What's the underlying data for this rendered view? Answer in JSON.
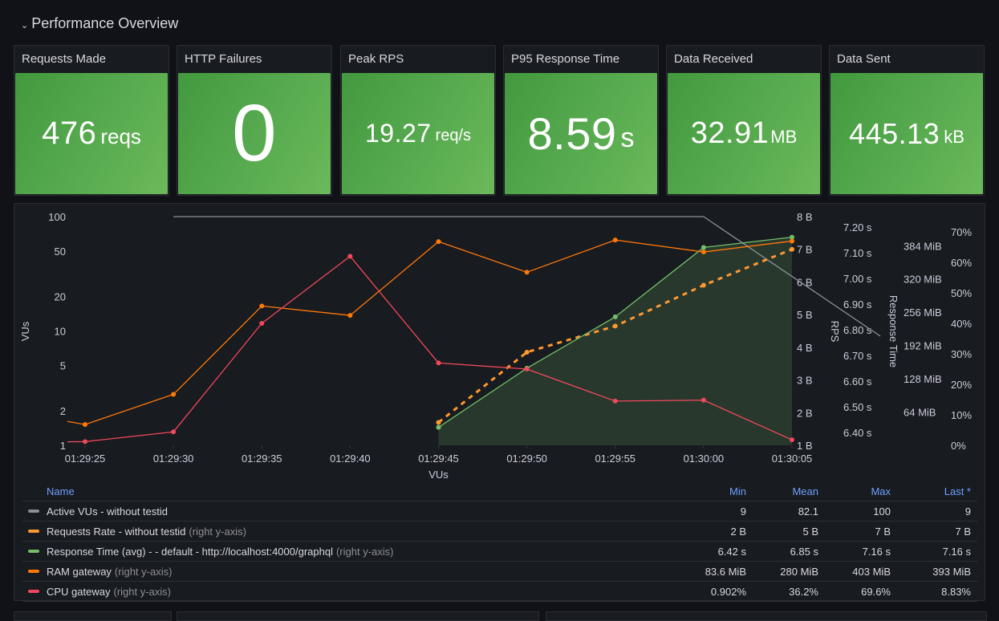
{
  "row": {
    "title": "Performance Overview",
    "collapse_icon": "chevron-down-icon"
  },
  "stats": [
    {
      "title": "Requests Made",
      "value": "476",
      "unit": "reqs"
    },
    {
      "title": "HTTP Failures",
      "value": "0",
      "unit": ""
    },
    {
      "title": "Peak RPS",
      "value": "19.27",
      "unit": "req/s"
    },
    {
      "title": "P95 Response Time",
      "value": "8.59",
      "unit": "s"
    },
    {
      "title": "Data Received",
      "value": "32.91",
      "unit": "MB"
    },
    {
      "title": "Data Sent",
      "value": "445.13",
      "unit": "kB"
    }
  ],
  "colors": {
    "stat_bg": "#56a94e",
    "vus": "#8e8e99",
    "rps": "#ff9830",
    "resp": "#73bf69",
    "ram": "#ff780a",
    "cpu": "#f2495c",
    "legend_header": "#6e9fff"
  },
  "chart_data": {
    "type": "line",
    "xlabel": "VUs",
    "x": [
      "01:29:25",
      "01:29:30",
      "01:29:35",
      "01:29:40",
      "01:29:45",
      "01:29:50",
      "01:29:55",
      "01:30:00",
      "01:30:05"
    ],
    "axes": {
      "left": {
        "label": "VUs",
        "scale": "log",
        "ticks": [
          "1",
          "2",
          "5",
          "10",
          "20",
          "50",
          "100"
        ],
        "range": [
          1,
          100
        ]
      },
      "rps": {
        "label": "RPS",
        "ticks": [
          "1 B",
          "2 B",
          "3 B",
          "4 B",
          "5 B",
          "6 B",
          "7 B",
          "8 B"
        ],
        "range": [
          1,
          8
        ]
      },
      "resp": {
        "label": "Response Time",
        "ticks": [
          "6.40 s",
          "6.50 s",
          "6.60 s",
          "6.70 s",
          "6.80 s",
          "6.90 s",
          "7.00 s",
          "7.10 s",
          "7.20 s"
        ],
        "range": [
          6.35,
          7.24
        ]
      },
      "ram": {
        "label": "",
        "ticks": [
          "64 MiB",
          "128 MiB",
          "192 MiB",
          "256 MiB",
          "320 MiB",
          "384 MiB"
        ],
        "range": [
          0,
          440
        ]
      },
      "cpu": {
        "label": "",
        "ticks": [
          "0%",
          "10%",
          "20%",
          "30%",
          "40%",
          "50%",
          "60%",
          "70%"
        ],
        "range": [
          0,
          75
        ]
      }
    },
    "series": [
      {
        "name": "Active VUs - without testid",
        "axis": "left",
        "color": "#8e8e99",
        "points": [
          [
            1.0,
            100
          ],
          [
            7.0,
            100
          ],
          [
            9.0,
            9
          ]
        ],
        "markers": false
      },
      {
        "name": "Requests Rate - without testid",
        "axis": "rps",
        "color": "#ff9830",
        "dashed": true,
        "points": [
          [
            4,
            1.7
          ],
          [
            5,
            3.85
          ],
          [
            6,
            4.65
          ],
          [
            7,
            5.9
          ],
          [
            8,
            7.0
          ]
        ],
        "markers": true
      },
      {
        "name": "Response Time (avg) - - default - http://localhost:4000/graphql",
        "axis": "resp",
        "color": "#73bf69",
        "fill": true,
        "points": [
          [
            4,
            6.42
          ],
          [
            5,
            6.65
          ],
          [
            6,
            6.85
          ],
          [
            7,
            7.12
          ],
          [
            8,
            7.16
          ]
        ],
        "markers": true
      },
      {
        "name": "RAM gateway",
        "axis": "ram",
        "color": "#ff780a",
        "points": [
          [
            -0.2,
            46
          ],
          [
            0,
            40
          ],
          [
            1,
            98
          ],
          [
            2,
            268
          ],
          [
            3,
            250
          ],
          [
            4,
            392
          ],
          [
            5,
            333
          ],
          [
            6,
            395
          ],
          [
            7,
            372
          ],
          [
            8,
            393
          ]
        ],
        "markers": true
      },
      {
        "name": "CPU gateway",
        "axis": "cpu",
        "color": "#f2495c",
        "points": [
          [
            -0.2,
            1.15
          ],
          [
            0,
            1.2
          ],
          [
            1,
            4.4
          ],
          [
            2,
            40
          ],
          [
            3,
            62
          ],
          [
            4,
            27
          ],
          [
            5,
            25
          ],
          [
            6,
            14.5
          ],
          [
            7,
            14.8
          ],
          [
            8,
            1.8
          ]
        ],
        "markers": true
      }
    ]
  },
  "legend": {
    "headers": {
      "name": "Name",
      "min": "Min",
      "mean": "Mean",
      "max": "Max",
      "last": "Last *"
    },
    "rows": [
      {
        "name": "Active VUs - without testid",
        "suffix": "",
        "color": "#8e8e99",
        "min": "9",
        "mean": "82.1",
        "max": "100",
        "last": "9"
      },
      {
        "name": "Requests Rate - without testid",
        "suffix": "(right y-axis)",
        "color": "#ff9830",
        "min": "2 B",
        "mean": "5 B",
        "max": "7 B",
        "last": "7 B"
      },
      {
        "name": "Response Time (avg) - - default - http://localhost:4000/graphql",
        "suffix": "(right y-axis)",
        "color": "#73bf69",
        "min": "6.42 s",
        "mean": "6.85 s",
        "max": "7.16 s",
        "last": "7.16 s"
      },
      {
        "name": "RAM gateway",
        "suffix": "(right y-axis)",
        "color": "#ff780a",
        "min": "83.6 MiB",
        "mean": "280 MiB",
        "max": "403 MiB",
        "last": "393 MiB"
      },
      {
        "name": "CPU gateway",
        "suffix": "(right y-axis)",
        "color": "#f2495c",
        "min": "0.902%",
        "mean": "36.2%",
        "max": "69.6%",
        "last": "8.83%"
      }
    ]
  }
}
